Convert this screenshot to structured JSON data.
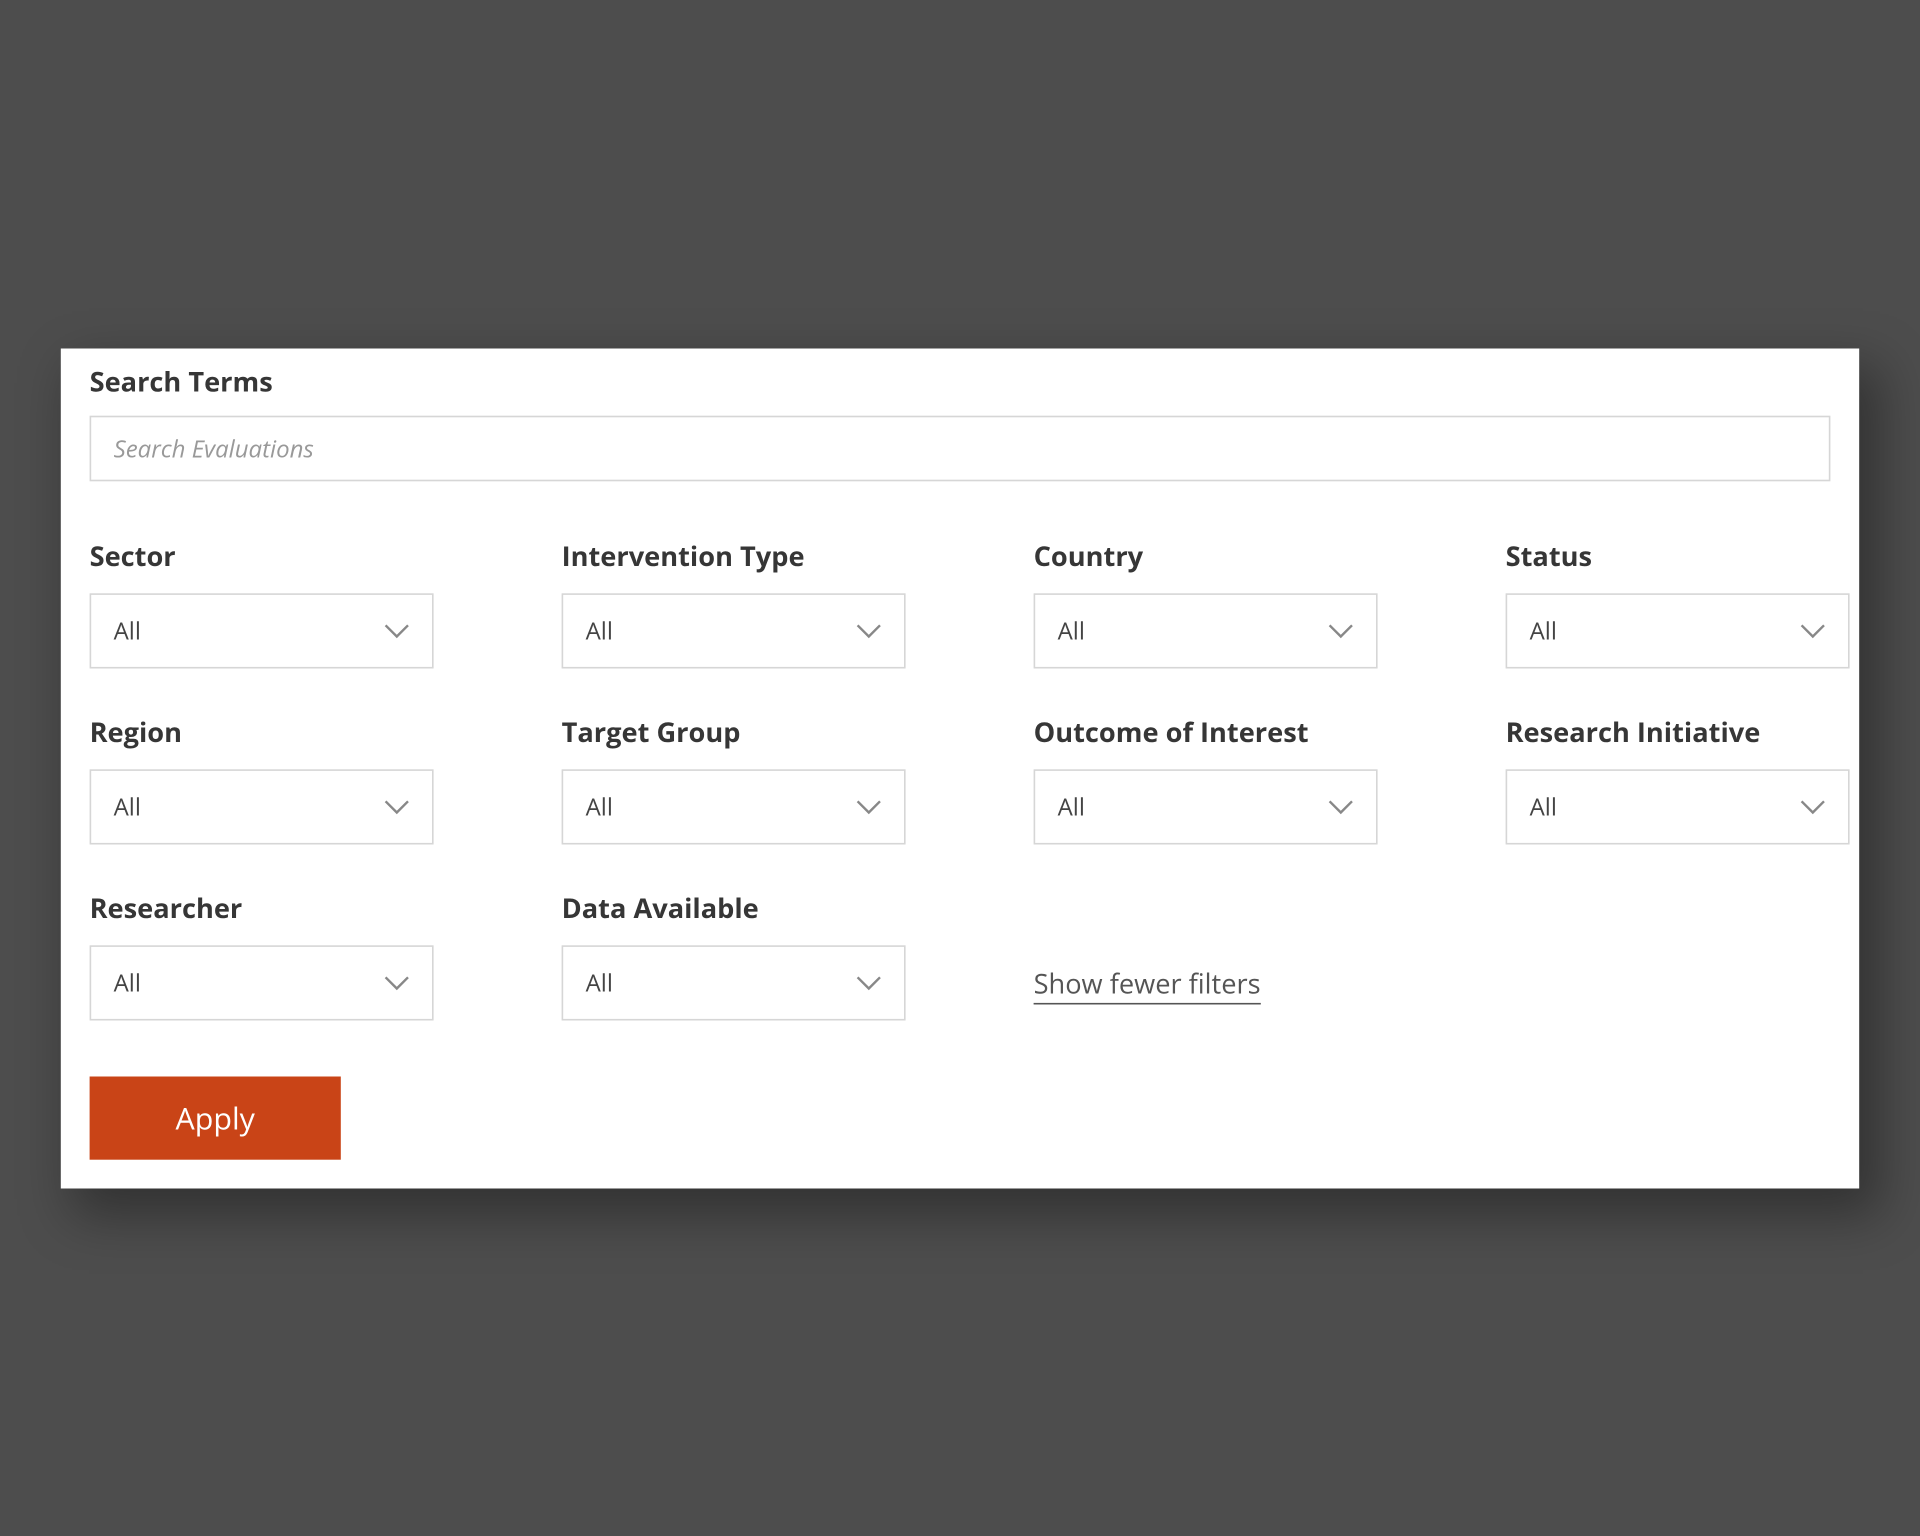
{
  "search": {
    "label": "Search Terms",
    "placeholder": "Search Evaluations"
  },
  "filters": {
    "sector": {
      "label": "Sector",
      "value": "All"
    },
    "intervention_type": {
      "label": "Intervention Type",
      "value": "All"
    },
    "country": {
      "label": "Country",
      "value": "All"
    },
    "status": {
      "label": "Status",
      "value": "All"
    },
    "region": {
      "label": "Region",
      "value": "All"
    },
    "target_group": {
      "label": "Target Group",
      "value": "All"
    },
    "outcome_of_interest": {
      "label": "Outcome of Interest",
      "value": "All"
    },
    "research_initiative": {
      "label": "Research Initiative",
      "value": "All"
    },
    "researcher": {
      "label": "Researcher",
      "value": "All"
    },
    "data_available": {
      "label": "Data Available",
      "value": "All"
    }
  },
  "links": {
    "toggle_filters": "Show fewer filters"
  },
  "buttons": {
    "apply": "Apply"
  }
}
